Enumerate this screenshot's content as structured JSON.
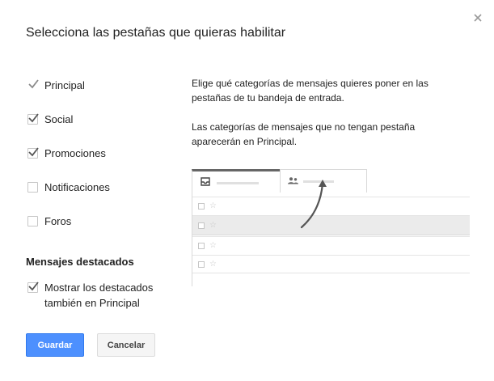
{
  "dialog": {
    "title": "Selecciona las pestañas que quieras habilitar",
    "close_icon": "close-icon"
  },
  "tabs": [
    {
      "label": "Principal",
      "checked": true,
      "disabled": true
    },
    {
      "label": "Social",
      "checked": true,
      "disabled": false
    },
    {
      "label": "Promociones",
      "checked": true,
      "disabled": false
    },
    {
      "label": "Notificaciones",
      "checked": false,
      "disabled": false
    },
    {
      "label": "Foros",
      "checked": false,
      "disabled": false
    }
  ],
  "starred": {
    "section_title": "Mensajes destacados",
    "option_line1": "Mostrar los destacados",
    "option_line2": "también en Principal",
    "checked": true
  },
  "help": {
    "paragraph1": "Elige qué categorías de mensajes quieres poner en las pestañas de tu bandeja de entrada.",
    "paragraph2": "Las categorías de mensajes que no tengan pestaña aparecerán en Principal."
  },
  "preview": {
    "tab_icons": [
      "inbox-icon",
      "people-icon"
    ],
    "row_count": 4,
    "shaded_row": 1,
    "star_glyph": "☆"
  },
  "buttons": {
    "save_label": "Guardar",
    "cancel_label": "Cancelar"
  },
  "colors": {
    "primary": "#4d90fe",
    "primary_border": "#3079ed",
    "checkmark": "#555555",
    "checkmark_disabled": "#8a8a8a"
  }
}
